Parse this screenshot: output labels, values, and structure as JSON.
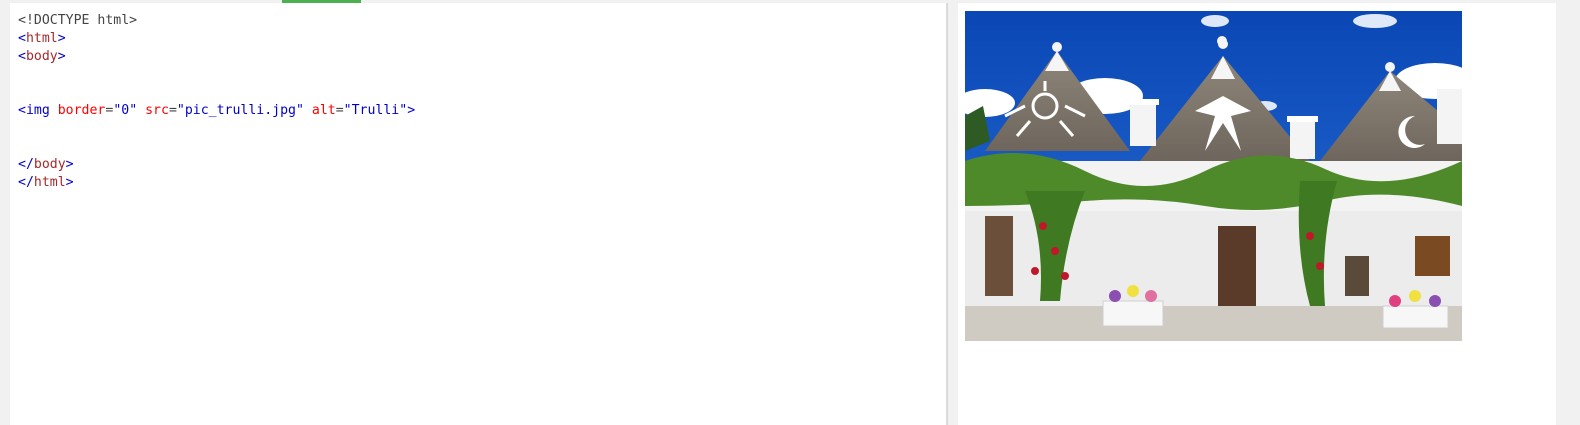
{
  "editor": {
    "lines": [
      {
        "type": "doctype",
        "text": "<!DOCTYPE html>"
      },
      {
        "type": "open",
        "tag": "html"
      },
      {
        "type": "open",
        "tag": "body"
      },
      {
        "type": "blank"
      },
      {
        "type": "blank"
      },
      {
        "type": "img",
        "tag": "img",
        "attrs": [
          {
            "name": "border",
            "value": "\"0\""
          },
          {
            "name": "src",
            "value": "\"pic_trulli.jpg\""
          },
          {
            "name": "alt",
            "value": "\"Trulli\""
          }
        ]
      },
      {
        "type": "blank"
      },
      {
        "type": "blank"
      },
      {
        "type": "close",
        "tag": "body"
      },
      {
        "type": "close",
        "tag": "html"
      }
    ]
  },
  "result": {
    "image": {
      "alt": "Trulli",
      "icon": "trulli-photo-icon"
    }
  },
  "colors": {
    "tab_indicator": "#4caf50",
    "bracket": "#0000cd",
    "tag": "#a52a2a",
    "attribute": "#ff0000",
    "value": "#0000cd"
  }
}
